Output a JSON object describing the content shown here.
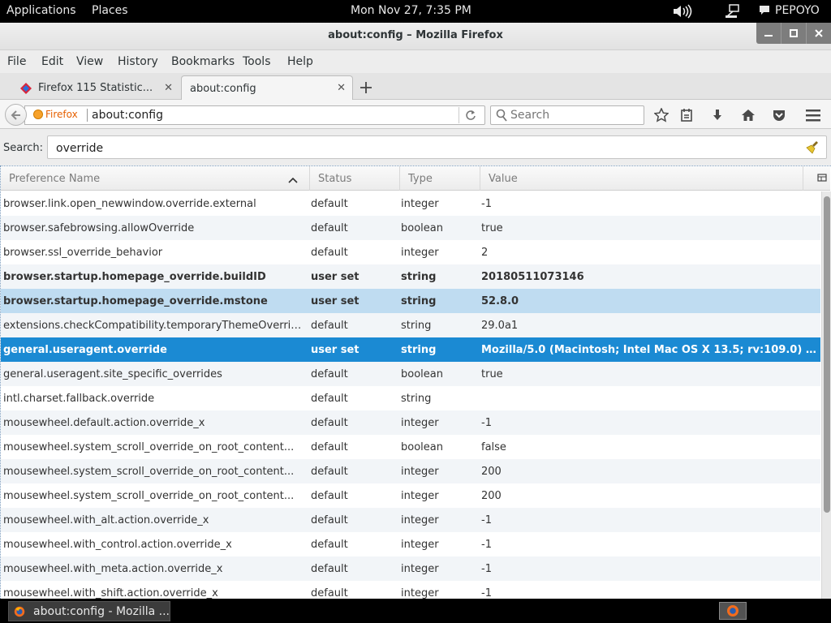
{
  "topbar": {
    "applications": "Applications",
    "places": "Places",
    "clock": "Mon Nov 27,  7:35 PM",
    "user": "PEPOYO"
  },
  "window": {
    "title": "about:config – Mozilla Firefox"
  },
  "menubar": {
    "file": "File",
    "edit": "Edit",
    "view": "View",
    "history": "History",
    "bookmarks": "Bookmarks",
    "tools": "Tools",
    "help": "Help"
  },
  "tabs": [
    {
      "label": "Firefox 115 Statistic..."
    },
    {
      "label": "about:config"
    }
  ],
  "navbar": {
    "identity_label": "Firefox",
    "url": "about:config",
    "search_placeholder": "Search"
  },
  "config": {
    "search_label": "Search:",
    "search_value": "override",
    "columns": {
      "name": "Preference Name",
      "status": "Status",
      "type": "Type",
      "value": "Value"
    },
    "rows": [
      {
        "name": "browser.link.open_newwindow.override.external",
        "status": "default",
        "type": "integer",
        "value": "-1"
      },
      {
        "name": "browser.safebrowsing.allowOverride",
        "status": "default",
        "type": "boolean",
        "value": "true"
      },
      {
        "name": "browser.ssl_override_behavior",
        "status": "default",
        "type": "integer",
        "value": "2"
      },
      {
        "name": "browser.startup.homepage_override.buildID",
        "status": "user set",
        "type": "string",
        "value": "20180511073146"
      },
      {
        "name": "browser.startup.homepage_override.mstone",
        "status": "user set",
        "type": "string",
        "value": "52.8.0"
      },
      {
        "name": "extensions.checkCompatibility.temporaryThemeOverrid...",
        "status": "default",
        "type": "string",
        "value": "29.0a1"
      },
      {
        "name": "general.useragent.override",
        "status": "user set",
        "type": "string",
        "value": "Mozilla/5.0 (Macintosh; Intel Mac OS X 13.5; rv:109.0) ..."
      },
      {
        "name": "general.useragent.site_specific_overrides",
        "status": "default",
        "type": "boolean",
        "value": "true"
      },
      {
        "name": "intl.charset.fallback.override",
        "status": "default",
        "type": "string",
        "value": ""
      },
      {
        "name": "mousewheel.default.action.override_x",
        "status": "default",
        "type": "integer",
        "value": "-1"
      },
      {
        "name": "mousewheel.system_scroll_override_on_root_content...",
        "status": "default",
        "type": "boolean",
        "value": "false"
      },
      {
        "name": "mousewheel.system_scroll_override_on_root_content...",
        "status": "default",
        "type": "integer",
        "value": "200"
      },
      {
        "name": "mousewheel.system_scroll_override_on_root_content...",
        "status": "default",
        "type": "integer",
        "value": "200"
      },
      {
        "name": "mousewheel.with_alt.action.override_x",
        "status": "default",
        "type": "integer",
        "value": "-1"
      },
      {
        "name": "mousewheel.with_control.action.override_x",
        "status": "default",
        "type": "integer",
        "value": "-1"
      },
      {
        "name": "mousewheel.with_meta.action.override_x",
        "status": "default",
        "type": "integer",
        "value": "-1"
      },
      {
        "name": "mousewheel.with_shift.action.override_x",
        "status": "default",
        "type": "integer",
        "value": "-1"
      }
    ]
  },
  "taskbar": {
    "window_label": "about:config - Mozilla ..."
  },
  "colors": {
    "selected_row": "#1b8ad3",
    "hover_row": "#bfdcf1",
    "identity_orange": "#e66000"
  }
}
